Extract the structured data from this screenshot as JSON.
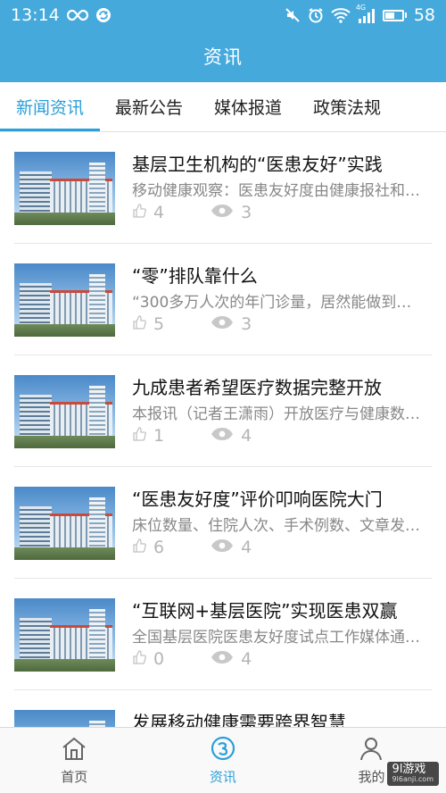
{
  "status_bar": {
    "time": "13:14",
    "network_label": "4G",
    "battery": "58",
    "battery_level": 0.58,
    "icons": [
      "infinity-icon",
      "sync-icon",
      "mute-icon",
      "alarm-icon",
      "wifi-icon",
      "signal-icon",
      "battery-icon"
    ]
  },
  "header": {
    "title": "资讯"
  },
  "tabs": [
    {
      "label": "新闻资讯",
      "active": true
    },
    {
      "label": "最新公告",
      "active": false
    },
    {
      "label": "媒体报道",
      "active": false
    },
    {
      "label": "政策法规",
      "active": false
    }
  ],
  "news": [
    {
      "title": "基层卫生机构的“医患友好”实践",
      "summary": "移动健康观察：医患友好度由健康报社和中国...",
      "likes": "4",
      "views": "3"
    },
    {
      "title": "“零”排队靠什么",
      "summary": "“300多万人次的年门诊量，居然能做到零排队...",
      "likes": "5",
      "views": "3"
    },
    {
      "title": "九成患者希望医疗数据完整开放",
      "summary": "本报讯（记者王潇雨）开放医疗与健康数据...",
      "likes": "1",
      "views": "4"
    },
    {
      "title": "“医患友好度”评价叩响医院大门",
      "summary": "床位数量、住院人次、手术例数、文章发表...",
      "likes": "6",
      "views": "4"
    },
    {
      "title": "“互联网+基层医院”实现医患双赢",
      "summary": "全国基层医院医患友好度试点工作媒体通气会...",
      "likes": "0",
      "views": "4"
    },
    {
      "title": "发展移动健康需要跨界智慧",
      "summary": "",
      "likes": "",
      "views": ""
    }
  ],
  "bottom_nav": [
    {
      "label": "首页",
      "icon": "home-icon",
      "active": false
    },
    {
      "label": "资讯",
      "icon": "news-icon",
      "active": true
    },
    {
      "label": "我的",
      "icon": "user-icon",
      "active": false
    }
  ],
  "watermark": {
    "brand": "9l游戏",
    "site": "9l6anji.com"
  },
  "colors": {
    "primary": "#45a9dc",
    "accent": "#2a9fd8",
    "meta": "#b5b5b5"
  }
}
